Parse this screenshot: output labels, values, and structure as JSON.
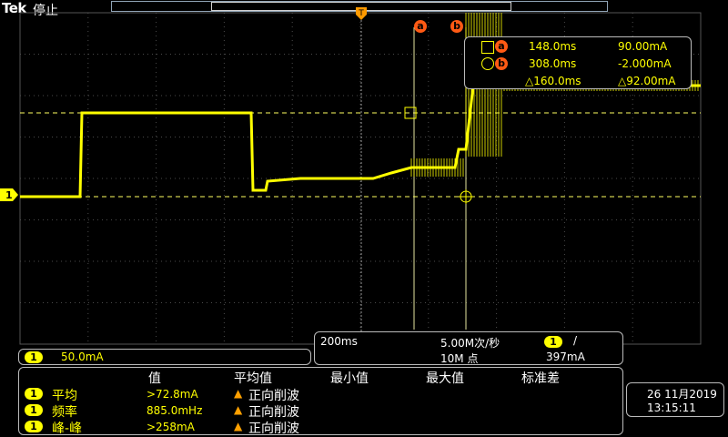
{
  "header": {
    "brand": "Tek",
    "status": "停止"
  },
  "cursors": {
    "a_label": "a",
    "b_label": "b",
    "a_time": "148.0ms",
    "a_value": "90.00mA",
    "b_time": "308.0ms",
    "b_value": "-2.000mA",
    "delta_time": "△160.0ms",
    "delta_value": "△92.00mA"
  },
  "channel": {
    "number": "1",
    "scale": "50.0mA"
  },
  "acquisition": {
    "timebase": "200ms",
    "sample_rate": "5.00M次/秒",
    "record_length": "10M 点",
    "trigger_channel": "1",
    "trigger_slope": "/",
    "trigger_level": "397mA"
  },
  "measurements": {
    "headers": [
      "值",
      "平均值",
      "最小值",
      "最大值",
      "标准差"
    ],
    "rows": [
      {
        "channel": "1",
        "name": "平均",
        "value": ">72.8mA",
        "note": "正向削波"
      },
      {
        "channel": "1",
        "name": "频率",
        "value": "885.0mHz",
        "note": "正向削波"
      },
      {
        "channel": "1",
        "name": "峰-峰",
        "value": ">258mA",
        "note": "正向削波"
      }
    ]
  },
  "datetime": {
    "date": "26 11月2019",
    "time": "13:15:11"
  },
  "colors": {
    "trace": "#ffff00",
    "cursor": "#ff5a14",
    "grid": "#5a5a5a",
    "trigger": "#ff9a00"
  },
  "trace_levels_mA": [
    -2,
    90,
    5,
    15,
    18,
    18,
    24,
    30,
    50,
    120,
    120
  ]
}
